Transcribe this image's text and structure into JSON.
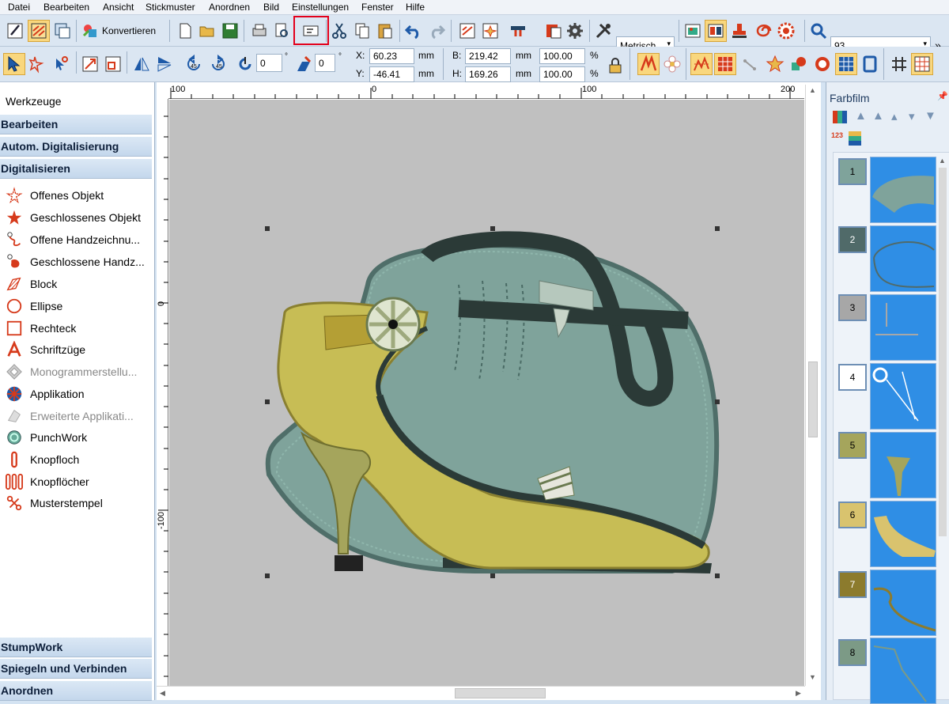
{
  "menu": [
    "Datei",
    "Bearbeiten",
    "Ansicht",
    "Stickmuster",
    "Anordnen",
    "Bild",
    "Einstellungen",
    "Fenster",
    "Hilfe"
  ],
  "toolbar1": {
    "convert_label": "Konvertieren",
    "units_value": "Metrisch",
    "zoom_value": "93"
  },
  "toolbar2": {
    "rotate_value": "0",
    "slant_value": "0",
    "degree_symbol": "°",
    "x_label": "X:",
    "x_value": "60.23",
    "y_label": "Y:",
    "y_value": "-46.41",
    "w_label": "B:",
    "w_value": "219.42",
    "h_label": "H:",
    "h_value": "169.26",
    "unit": "mm",
    "w_pct": "100.00",
    "h_pct": "100.00",
    "pct_symbol": "%"
  },
  "left_panel": {
    "title": "Werkzeuge",
    "categories_top": [
      "Bearbeiten",
      "Autom. Digitalisierung",
      "Digitalisieren"
    ],
    "tools": [
      {
        "label": "Offenes Objekt",
        "icon": "open-object-icon",
        "enabled": true
      },
      {
        "label": "Geschlossenes Objekt",
        "icon": "closed-object-icon",
        "enabled": true
      },
      {
        "label": "Offene Handzeichnu...",
        "icon": "open-freehand-icon",
        "enabled": true
      },
      {
        "label": "Geschlossene Handz...",
        "icon": "closed-freehand-icon",
        "enabled": true
      },
      {
        "label": "Block",
        "icon": "block-icon",
        "enabled": true
      },
      {
        "label": "Ellipse",
        "icon": "ellipse-icon",
        "enabled": true
      },
      {
        "label": "Rechteck",
        "icon": "rectangle-icon",
        "enabled": true
      },
      {
        "label": "Schriftzüge",
        "icon": "lettering-icon",
        "enabled": true
      },
      {
        "label": "Monogrammerstellu...",
        "icon": "monogram-icon",
        "enabled": false
      },
      {
        "label": "Applikation",
        "icon": "applique-icon",
        "enabled": true
      },
      {
        "label": "Erweiterte Applikati...",
        "icon": "advanced-applique-icon",
        "enabled": false
      },
      {
        "label": "PunchWork",
        "icon": "punchwork-icon",
        "enabled": true
      },
      {
        "label": "Knopfloch",
        "icon": "buttonhole-icon",
        "enabled": true
      },
      {
        "label": "Knopflöcher",
        "icon": "buttonholes-icon",
        "enabled": true
      },
      {
        "label": "Musterstempel",
        "icon": "pattern-stamp-icon",
        "enabled": true
      }
    ],
    "categories_bottom": [
      "StumpWork",
      "Spiegeln und Verbinden",
      "Anordnen"
    ]
  },
  "rulers": {
    "h_ticks": [
      "100",
      "0",
      "100",
      "200"
    ],
    "v_ticks": [
      "0",
      "-100"
    ]
  },
  "right_panel": {
    "title": "Farbfilm",
    "pin_icon": "pin-icon",
    "colors": [
      {
        "num": "1",
        "color": "#7fa39b",
        "selected": false
      },
      {
        "num": "2",
        "color": "#506a69",
        "selected": false
      },
      {
        "num": "3",
        "color": "#a7a7a7",
        "selected": false
      },
      {
        "num": "4",
        "color": "#ffffff",
        "selected": true
      },
      {
        "num": "5",
        "color": "#a5a55c",
        "selected": false
      },
      {
        "num": "6",
        "color": "#d9c36e",
        "selected": false
      },
      {
        "num": "7",
        "color": "#8c7b2d",
        "selected": false
      },
      {
        "num": "8",
        "color": "#7c9a86",
        "selected": false
      }
    ]
  }
}
